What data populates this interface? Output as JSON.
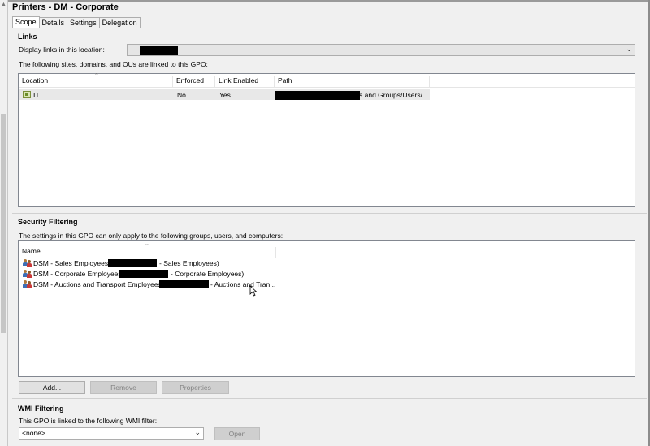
{
  "window": {
    "title": "Printers - DM - Corporate",
    "tabs": [
      {
        "label": "Scope",
        "active": true
      },
      {
        "label": "Details",
        "active": false
      },
      {
        "label": "Settings",
        "active": false
      },
      {
        "label": "Delegation",
        "active": false
      }
    ]
  },
  "links": {
    "heading": "Links",
    "display_label": "Display links in this location:",
    "location_value": "",
    "list_caption": "The following sites, domains, and OUs are linked to this GPO:",
    "columns": [
      "Location",
      "Enforced",
      "Link Enabled",
      "Path"
    ],
    "rows": [
      {
        "location": "IT",
        "enforced": "No",
        "link_enabled": "Yes",
        "path_suffix": "s and Groups/Users/..."
      }
    ]
  },
  "security_filtering": {
    "heading": "Security Filtering",
    "caption": "The settings in this GPO can only apply to the following groups, users, and computers:",
    "column": "Name",
    "rows": [
      {
        "name": "DSM - Sales Employees (",
        "suffix": "- Sales Employees)"
      },
      {
        "name": "DSM - Corporate Employees (",
        "suffix": "- Corporate Employees)"
      },
      {
        "name": "DSM - Auctions and Transport Employees (",
        "suffix": "- Auctions and Tran..."
      }
    ],
    "buttons": {
      "add": "Add...",
      "remove": "Remove",
      "properties": "Properties"
    }
  },
  "wmi_filtering": {
    "heading": "WMI Filtering",
    "caption": "This GPO is linked to the following WMI filter:",
    "selected": "<none>",
    "open_button": "Open"
  },
  "icons": {
    "ou": "ou-icon",
    "group": "group-icon",
    "dropdown": "chevron-down-icon",
    "sort": "sort-arrow-icon"
  },
  "colors": {
    "background": "#f0f0f0",
    "selected_row": "#e8e8e8",
    "disabled_text": "#838383"
  }
}
